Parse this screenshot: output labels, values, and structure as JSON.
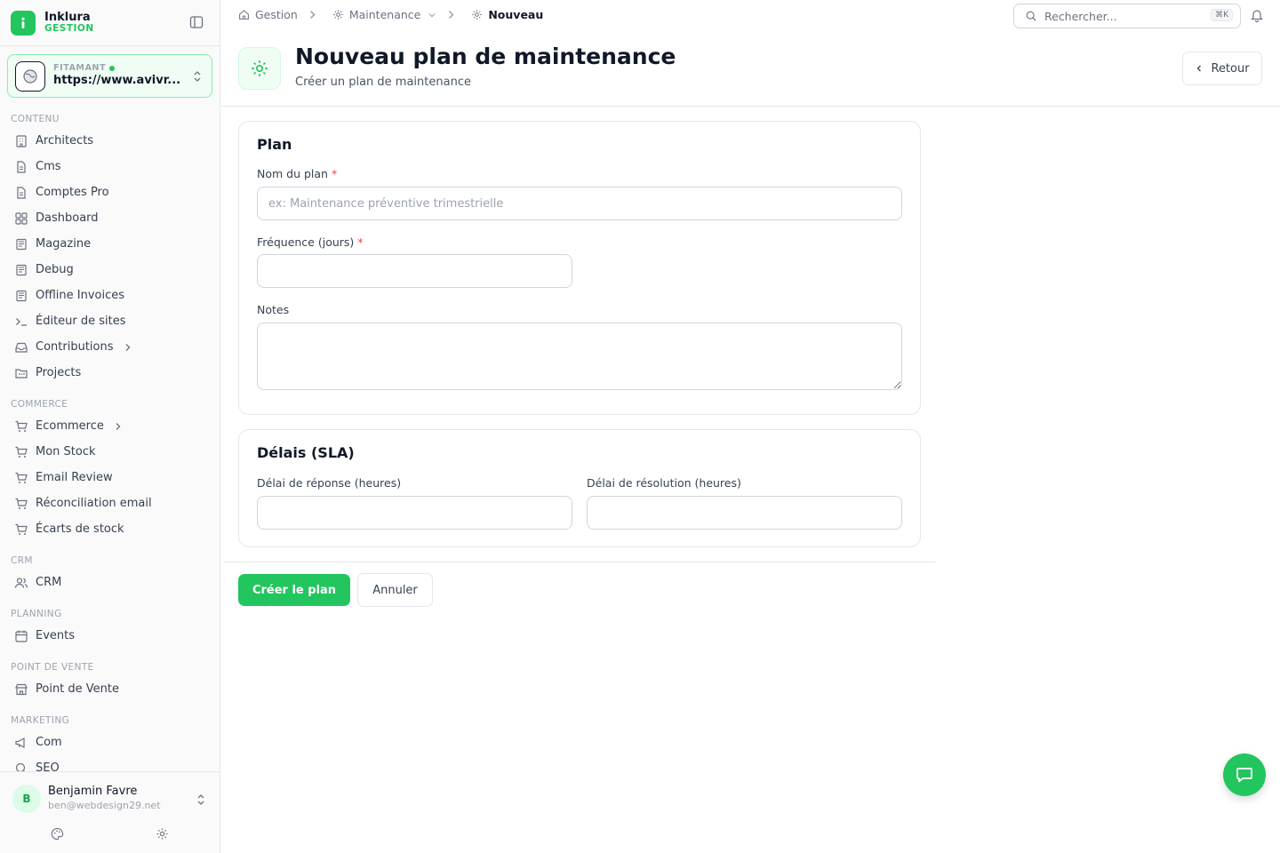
{
  "brand": {
    "name": "Inklura",
    "sub": "GESTION"
  },
  "site": {
    "label": "FITAMANT",
    "url": "https://www.avivr..."
  },
  "sidebar": {
    "sections": {
      "contenu": "CONTENU",
      "commerce": "COMMERCE",
      "crm": "CRM",
      "planning": "PLANNING",
      "pos": "POINT DE VENTE",
      "marketing": "MARKETING"
    },
    "items": {
      "architects": "Architects",
      "cms": "Cms",
      "comptes_pro": "Comptes Pro",
      "dashboard": "Dashboard",
      "magazine": "Magazine",
      "debug": "Debug",
      "offline_invoices": "Offline Invoices",
      "editeur": "Éditeur de sites",
      "contributions": "Contributions",
      "projects": "Projects",
      "ecommerce": "Ecommerce",
      "mon_stock": "Mon Stock",
      "email_review": "Email Review",
      "reconciliation": "Réconciliation email",
      "ecarts": "Écarts de stock",
      "crm": "CRM",
      "events": "Events",
      "point_de_vente": "Point de Vente",
      "com": "Com",
      "seo": "SEO"
    }
  },
  "user": {
    "initial": "B",
    "name": "Benjamin Favre",
    "email": "ben@webdesign29.net"
  },
  "breadcrumb": {
    "home": "Gestion",
    "section": "Maintenance",
    "current": "Nouveau"
  },
  "search": {
    "placeholder": "Rechercher...",
    "shortcut": "⌘K"
  },
  "header": {
    "title": "Nouveau plan de maintenance",
    "subtitle": "Créer un plan de maintenance",
    "back_label": "Retour"
  },
  "plan_card": {
    "title": "Plan",
    "name_label": "Nom du plan",
    "name_placeholder": "ex: Maintenance préventive trimestrielle",
    "name_value": "",
    "frequency_label": "Fréquence (jours)",
    "frequency_value": "",
    "notes_label": "Notes",
    "notes_value": "",
    "required_mark": "*"
  },
  "sla_card": {
    "title": "Délais (SLA)",
    "response_label": "Délai de réponse (heures)",
    "response_value": "",
    "resolution_label": "Délai de résolution (heures)",
    "resolution_value": ""
  },
  "actions": {
    "submit_label": "Créer le plan",
    "cancel_label": "Annuler"
  },
  "colors": {
    "accent": "#22c55e",
    "required": "#ef4444",
    "border": "#e5e7eb"
  },
  "icons": {
    "brand": "info-icon",
    "collapse": "sidebar-toggle-icon",
    "site": "globe-icon",
    "home": "home-icon",
    "gear": "gear-icon",
    "search": "search-icon",
    "bell": "bell-icon",
    "chat": "chat-icon",
    "palette": "palette-icon"
  }
}
